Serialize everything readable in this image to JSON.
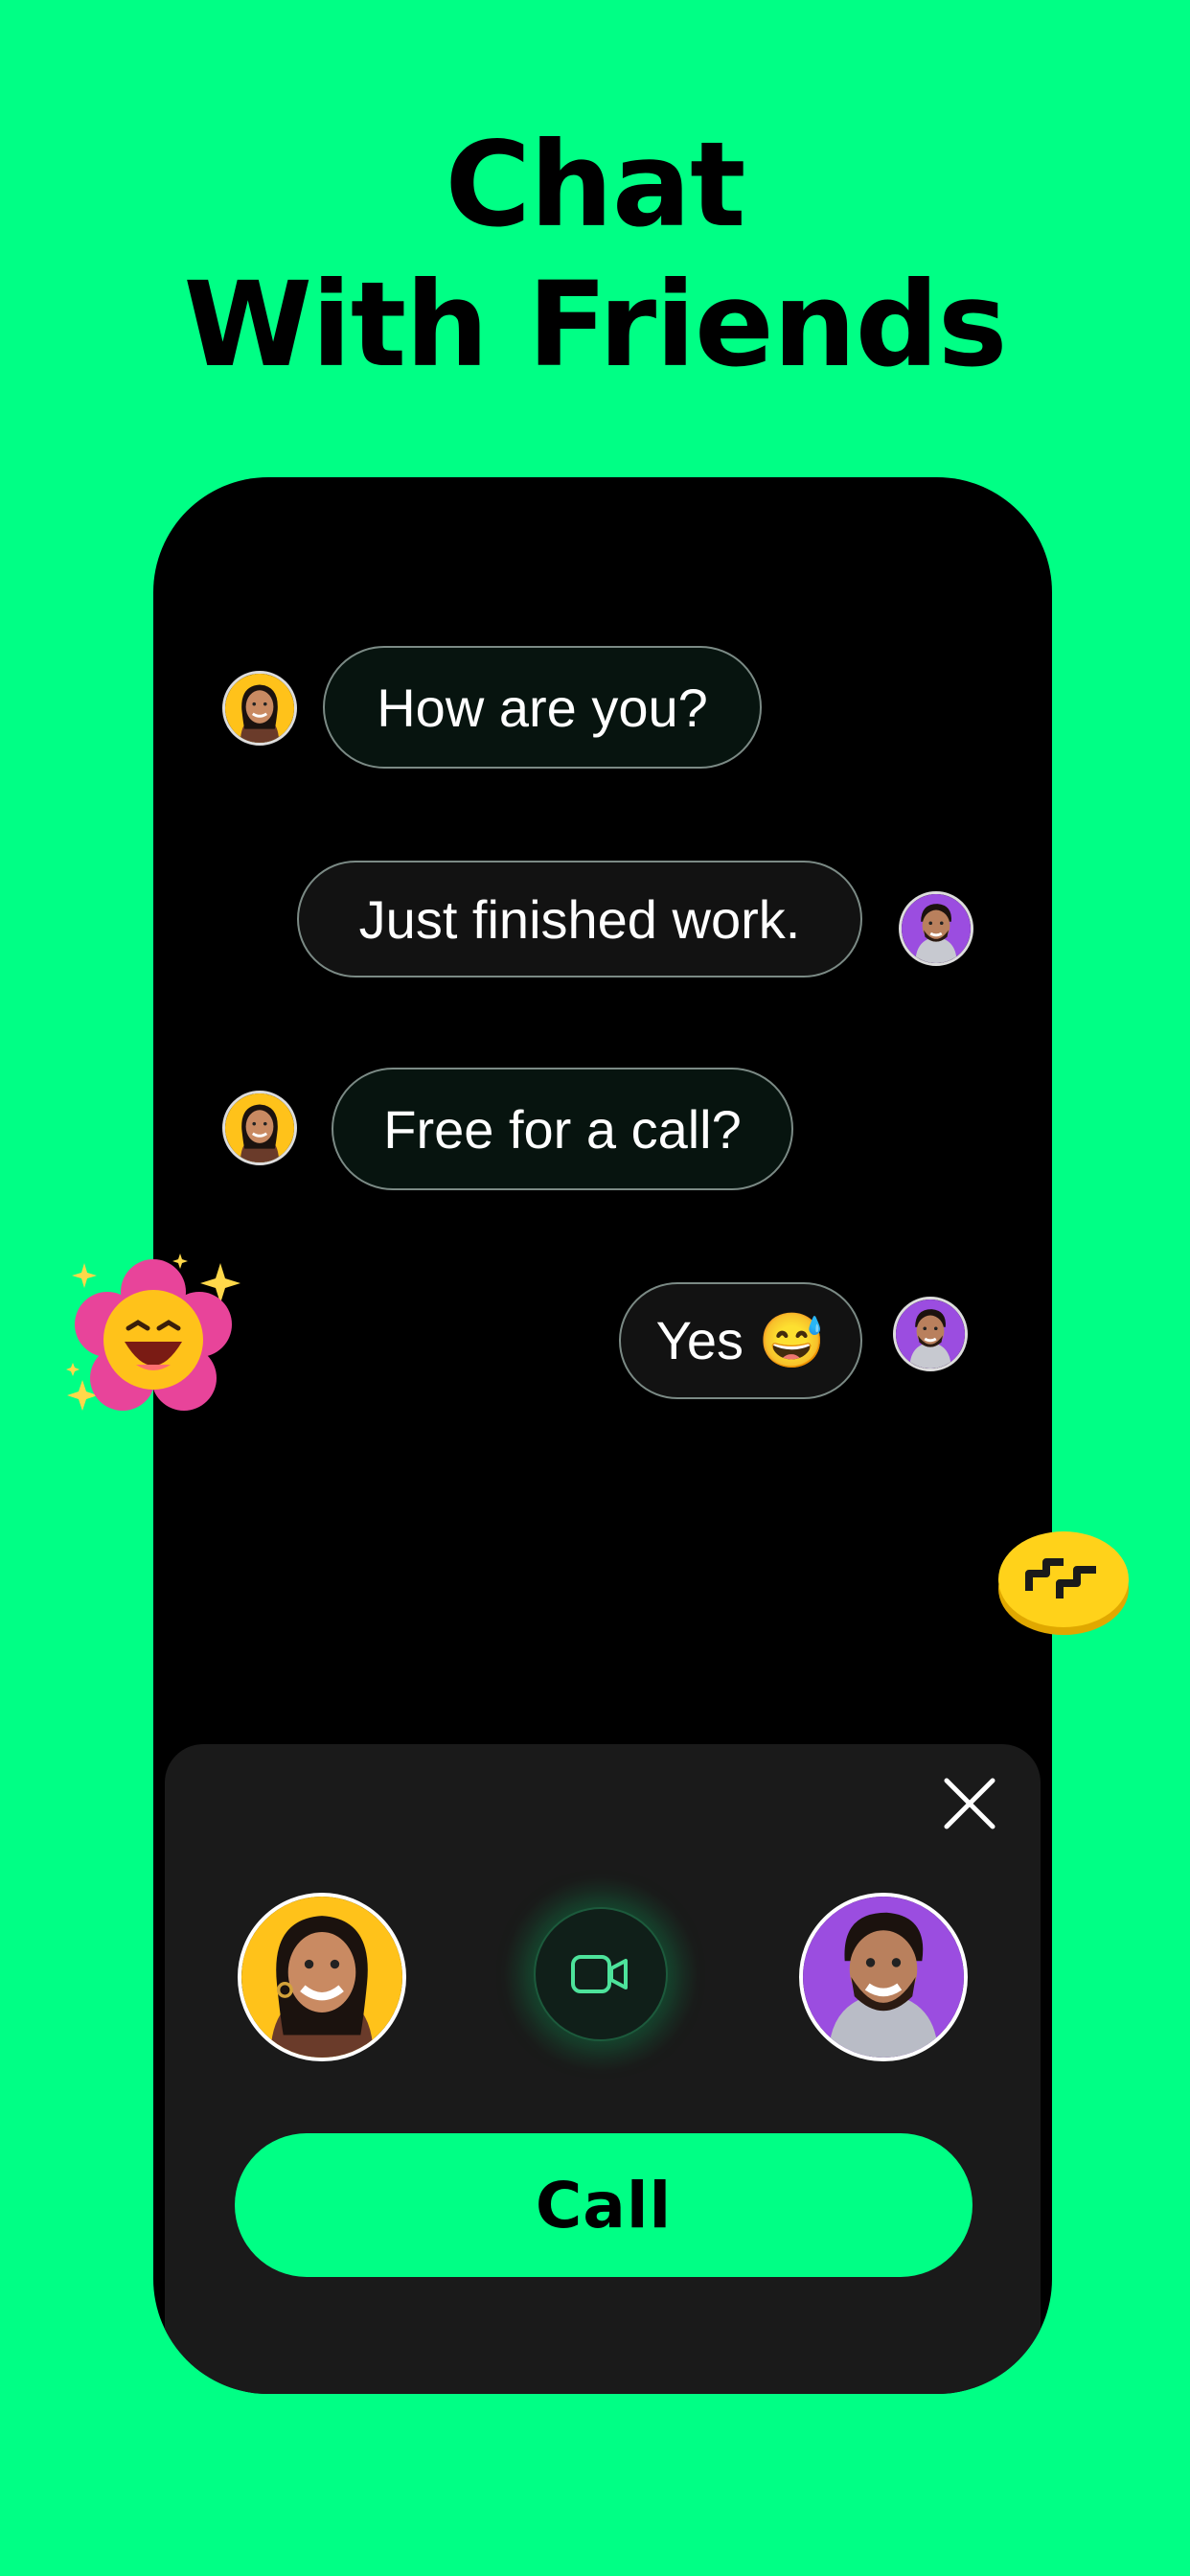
{
  "headline": {
    "line1": "Chat",
    "line2": "With Friends"
  },
  "messages": [
    {
      "text": "How are you?",
      "side": "left"
    },
    {
      "text": "Just finished work.",
      "side": "right"
    },
    {
      "text": "Free for a call?",
      "side": "left"
    },
    {
      "text": "Yes 😅",
      "side": "right"
    }
  ],
  "call_sheet": {
    "call_label": "Call"
  },
  "icons": {
    "close": "close-icon",
    "video": "video-camera-icon",
    "flower_sticker": "laughing-flower-sticker",
    "coin_sticker": "coin-sticker"
  },
  "colors": {
    "background": "#00FF85",
    "phone": "#000000",
    "sheet": "#1A1A1A",
    "accent": "#00FF85",
    "avatar_female_bg": "#FFC21A",
    "avatar_male_bg": "#9B4DE0"
  }
}
